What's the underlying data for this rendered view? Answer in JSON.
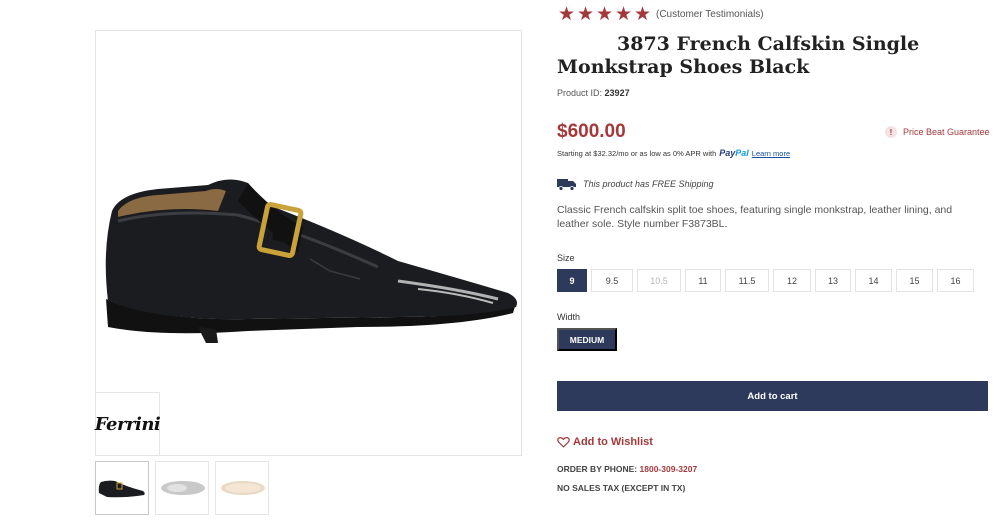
{
  "rating": {
    "stars": 5,
    "text": "(Customer Testimonials)",
    "star_color": "#a5383b"
  },
  "product": {
    "title": "3873 French Calfskin Single Monkstrap Shoes Black",
    "id_label": "Product ID:",
    "id_value": "23927",
    "price": "$600.00",
    "price_guarantee": "Price Beat Guarantee",
    "financing_text": "Starting at $32.32/mo or as low as 0% APR with",
    "paypal_a": "Pay",
    "paypal_b": "Pal",
    "learn_more": "Learn more",
    "shipping_text": "This product has FREE Shipping",
    "description": "Classic French calfskin split toe shoes, featuring single monkstrap, leather lining, and leather sole. Style number F3873BL."
  },
  "gallery": {
    "brand": "Ferrini",
    "thumbnails": [
      "side-view",
      "top-view",
      "sole-view"
    ]
  },
  "size": {
    "label": "Size",
    "options": [
      "9",
      "9.5",
      "10.5",
      "11",
      "11.5",
      "12",
      "13",
      "14",
      "15",
      "16"
    ],
    "selected": "9",
    "disabled": [
      "10.5"
    ]
  },
  "width": {
    "label": "Width",
    "selected": "MEDIUM"
  },
  "actions": {
    "add_to_cart": "Add to cart",
    "wishlist": "Add to Wishlist"
  },
  "contact": {
    "order_label": "ORDER BY PHONE:",
    "phone": "1800-309-3207",
    "tax_note": "NO SALES TAX (EXCEPT IN TX)"
  },
  "colors": {
    "accent": "#a5383b",
    "primary": "#2e3a5c"
  }
}
